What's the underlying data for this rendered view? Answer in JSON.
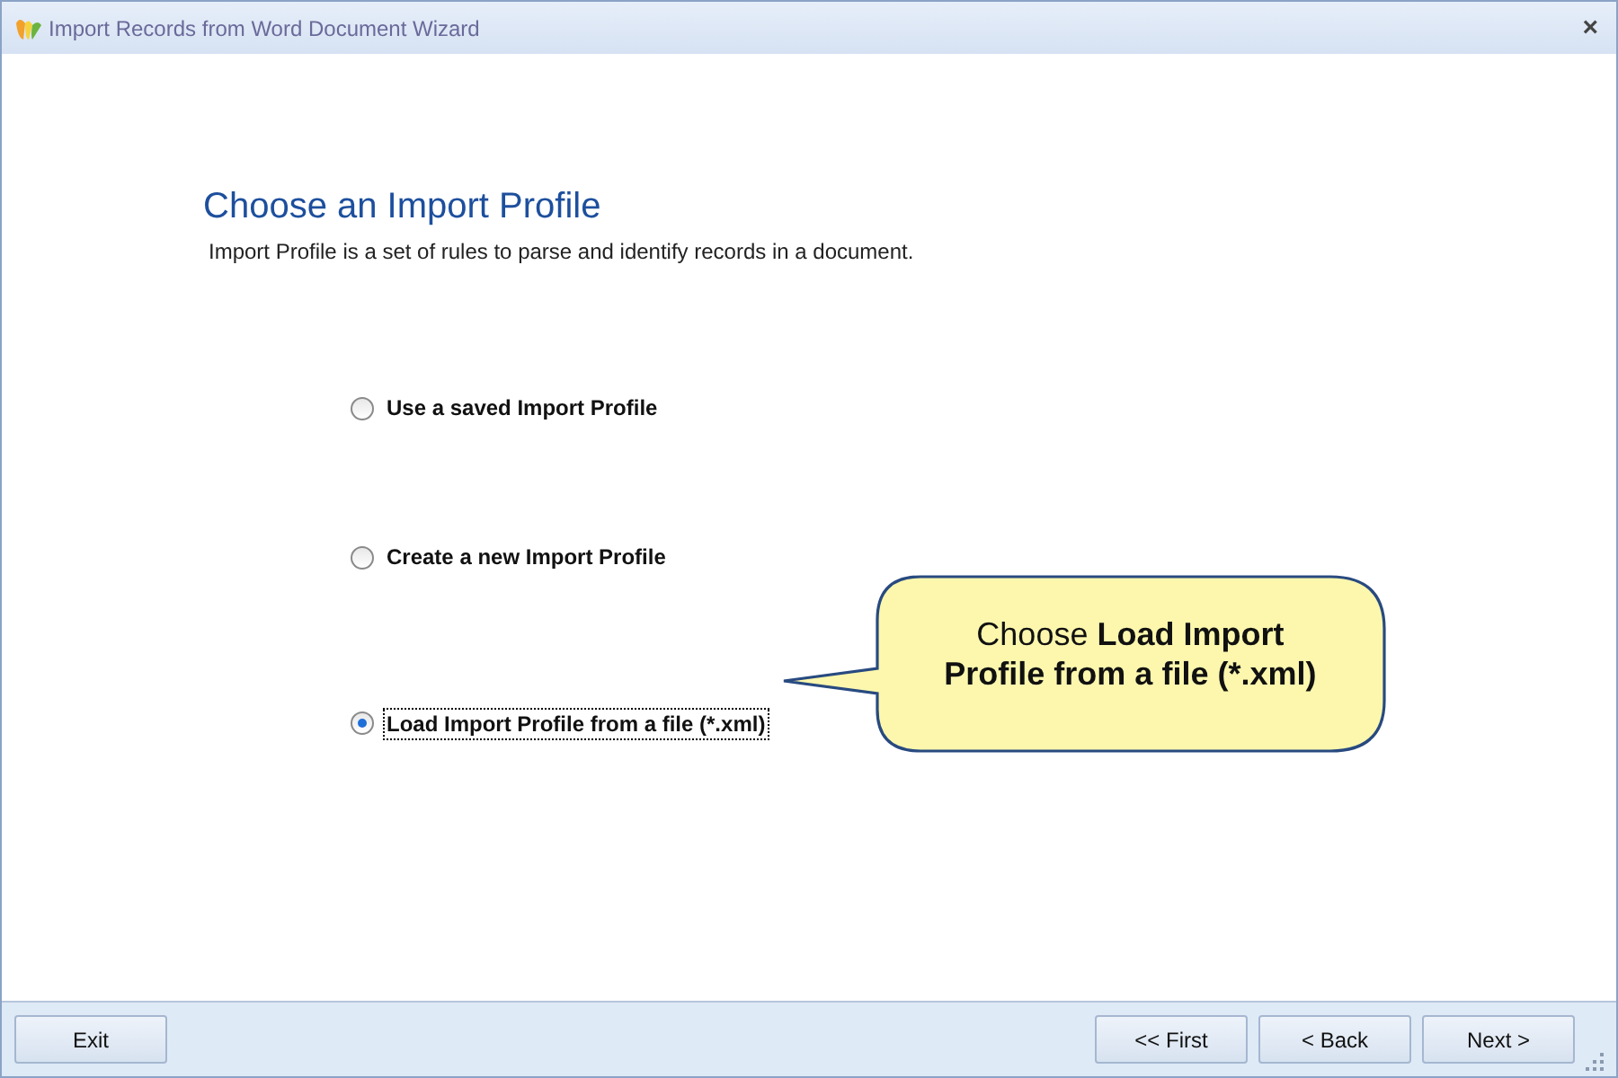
{
  "window": {
    "title": "Import Records from Word Document Wizard",
    "close": "×"
  },
  "heading": "Choose an Import Profile",
  "description": "Import Profile is a set of rules to parse and identify records in a document.",
  "options": [
    {
      "label": "Use a saved Import Profile",
      "selected": false
    },
    {
      "label": "Create a new Import Profile",
      "selected": false
    },
    {
      "label": "Load Import Profile from a file (*.xml)",
      "selected": true
    }
  ],
  "callout": {
    "text": "Choose",
    "emphasis": "Load Import Profile from a file (*.xml)"
  },
  "buttons": {
    "left": [
      "Exit"
    ],
    "right": [
      "<< First",
      "< Back",
      "Next >"
    ]
  }
}
